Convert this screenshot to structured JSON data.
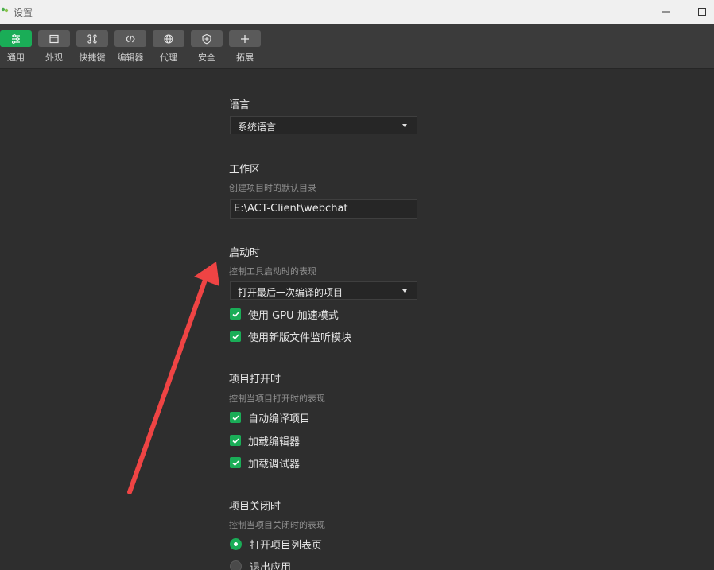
{
  "window": {
    "title": "设置"
  },
  "toolbar": {
    "items": [
      {
        "label": "通用",
        "icon": "sliders-icon",
        "active": true
      },
      {
        "label": "外观",
        "icon": "window-icon",
        "active": false
      },
      {
        "label": "快捷键",
        "icon": "command-icon",
        "active": false
      },
      {
        "label": "编辑器",
        "icon": "code-icon",
        "active": false
      },
      {
        "label": "代理",
        "icon": "globe-icon",
        "active": false
      },
      {
        "label": "安全",
        "icon": "shield-icon",
        "active": false
      },
      {
        "label": "拓展",
        "icon": "plus-icon",
        "active": false
      }
    ]
  },
  "language": {
    "title": "语言",
    "selected": "系统语言"
  },
  "workspace": {
    "title": "工作区",
    "description": "创建项目时的默认目录",
    "path": "E:\\ACT-Client\\webchat"
  },
  "startup": {
    "title": "启动时",
    "description": "控制工具启动时的表现",
    "selected": "打开最后一次编译的项目",
    "options": [
      {
        "label": "使用 GPU 加速模式",
        "checked": true
      },
      {
        "label": "使用新版文件监听模块",
        "checked": true
      }
    ]
  },
  "project_open": {
    "title": "项目打开时",
    "description": "控制当项目打开时的表现",
    "options": [
      {
        "label": "自动编译项目",
        "checked": true
      },
      {
        "label": "加载编辑器",
        "checked": true
      },
      {
        "label": "加载调试器",
        "checked": true
      }
    ]
  },
  "project_close": {
    "title": "项目关闭时",
    "description": "控制当项目关闭时的表现",
    "options": [
      {
        "label": "打开项目列表页",
        "selected": true
      },
      {
        "label": "退出应用",
        "selected": false
      }
    ]
  },
  "colors": {
    "accent": "#1aad57",
    "annotation_arrow": "#ef4444",
    "background": "#2e2e2e"
  }
}
